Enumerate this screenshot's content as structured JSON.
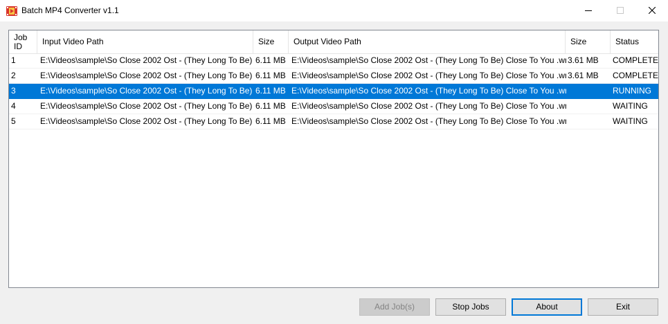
{
  "window": {
    "title": "Batch MP4 Converter v1.1"
  },
  "table": {
    "headers": {
      "job_id": "Job\nID",
      "input_path": "Input Video Path",
      "input_size": "Size",
      "output_path": "Output Video Path",
      "output_size": "Size",
      "status": "Status"
    },
    "rows": [
      {
        "id": "1",
        "input": "E:\\Videos\\sample\\So Close 2002 Ost - (They Long To Be) Cl...",
        "in_size": "6.11 MB",
        "output": "E:\\Videos\\sample\\So Close 2002 Ost - (They Long To Be) Close To You .wmv ...",
        "out_size": "3.61 MB",
        "status": "COMPLETED"
      },
      {
        "id": "2",
        "input": "E:\\Videos\\sample\\So Close 2002 Ost - (They Long To Be) Cl...",
        "in_size": "6.11 MB",
        "output": "E:\\Videos\\sample\\So Close 2002 Ost - (They Long To Be) Close To You .wmv ...",
        "out_size": "3.61 MB",
        "status": "COMPLETED"
      },
      {
        "id": "3",
        "input": "E:\\Videos\\sample\\So Close 2002 Ost - (They Long To Be) Cl...",
        "in_size": "6.11 MB",
        "output": "E:\\Videos\\sample\\So Close 2002 Ost - (They Long To Be) Close To You .wmv ...",
        "out_size": "",
        "status": "RUNNING"
      },
      {
        "id": "4",
        "input": "E:\\Videos\\sample\\So Close 2002 Ost - (They Long To Be) Cl...",
        "in_size": "6.11 MB",
        "output": "E:\\Videos\\sample\\So Close 2002 Ost - (They Long To Be) Close To You .wmv ...",
        "out_size": "",
        "status": "WAITING"
      },
      {
        "id": "5",
        "input": "E:\\Videos\\sample\\So Close 2002 Ost - (They Long To Be) Cl...",
        "in_size": "6.11 MB",
        "output": "E:\\Videos\\sample\\So Close 2002 Ost - (They Long To Be) Close To You .wmv ...",
        "out_size": "",
        "status": "WAITING"
      }
    ],
    "selected_row": 3
  },
  "buttons": {
    "add_jobs": "Add Job(s)",
    "stop_jobs": "Stop Jobs",
    "about": "About",
    "exit": "Exit"
  },
  "icons": {
    "app": "video-film-icon",
    "minimize": "minimize-icon",
    "maximize": "maximize-icon",
    "close": "close-icon"
  },
  "colors": {
    "selection": "#0078d7",
    "app_icon": "#e0392b"
  }
}
